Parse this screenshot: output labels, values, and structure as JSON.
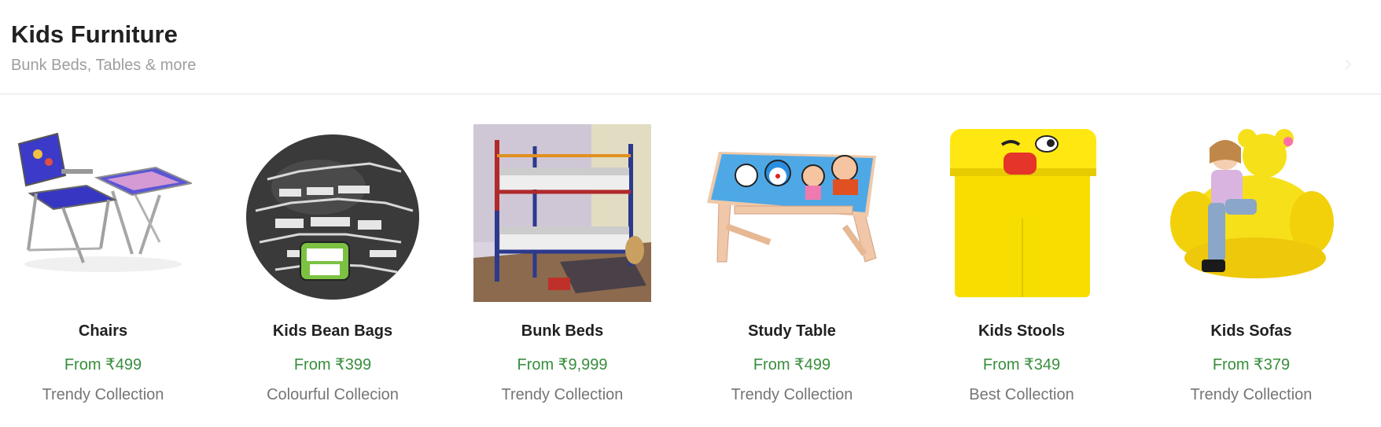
{
  "section": {
    "title": "Kids Furniture",
    "subtitle": "Bunk Beds, Tables & more"
  },
  "products": [
    {
      "name": "Chairs",
      "price": "From ₹499",
      "tagline": "Trendy Collection",
      "image": "kids-chair-table-set-image"
    },
    {
      "name": "Kids Bean Bags",
      "price": "From ₹399",
      "tagline": "Colourful Collecion",
      "image": "ben10-bean-bag-image"
    },
    {
      "name": "Bunk Beds",
      "price": "From ₹9,999",
      "tagline": "Trendy Collection",
      "image": "bunk-bed-image"
    },
    {
      "name": "Study Table",
      "price": "From ₹499",
      "tagline": "Trendy Collection",
      "image": "doraemon-study-table-image"
    },
    {
      "name": "Kids Stools",
      "price": "From ₹349",
      "tagline": "Best Collection",
      "image": "yellow-emoji-stool-image"
    },
    {
      "name": "Kids Sofas",
      "price": "From ₹379",
      "tagline": "Trendy Collection",
      "image": "teddy-inflatable-sofa-image"
    }
  ],
  "colors": {
    "price": "#388e3c",
    "title": "#212121",
    "subtitle": "#9e9e9e",
    "tagline": "#757575"
  }
}
